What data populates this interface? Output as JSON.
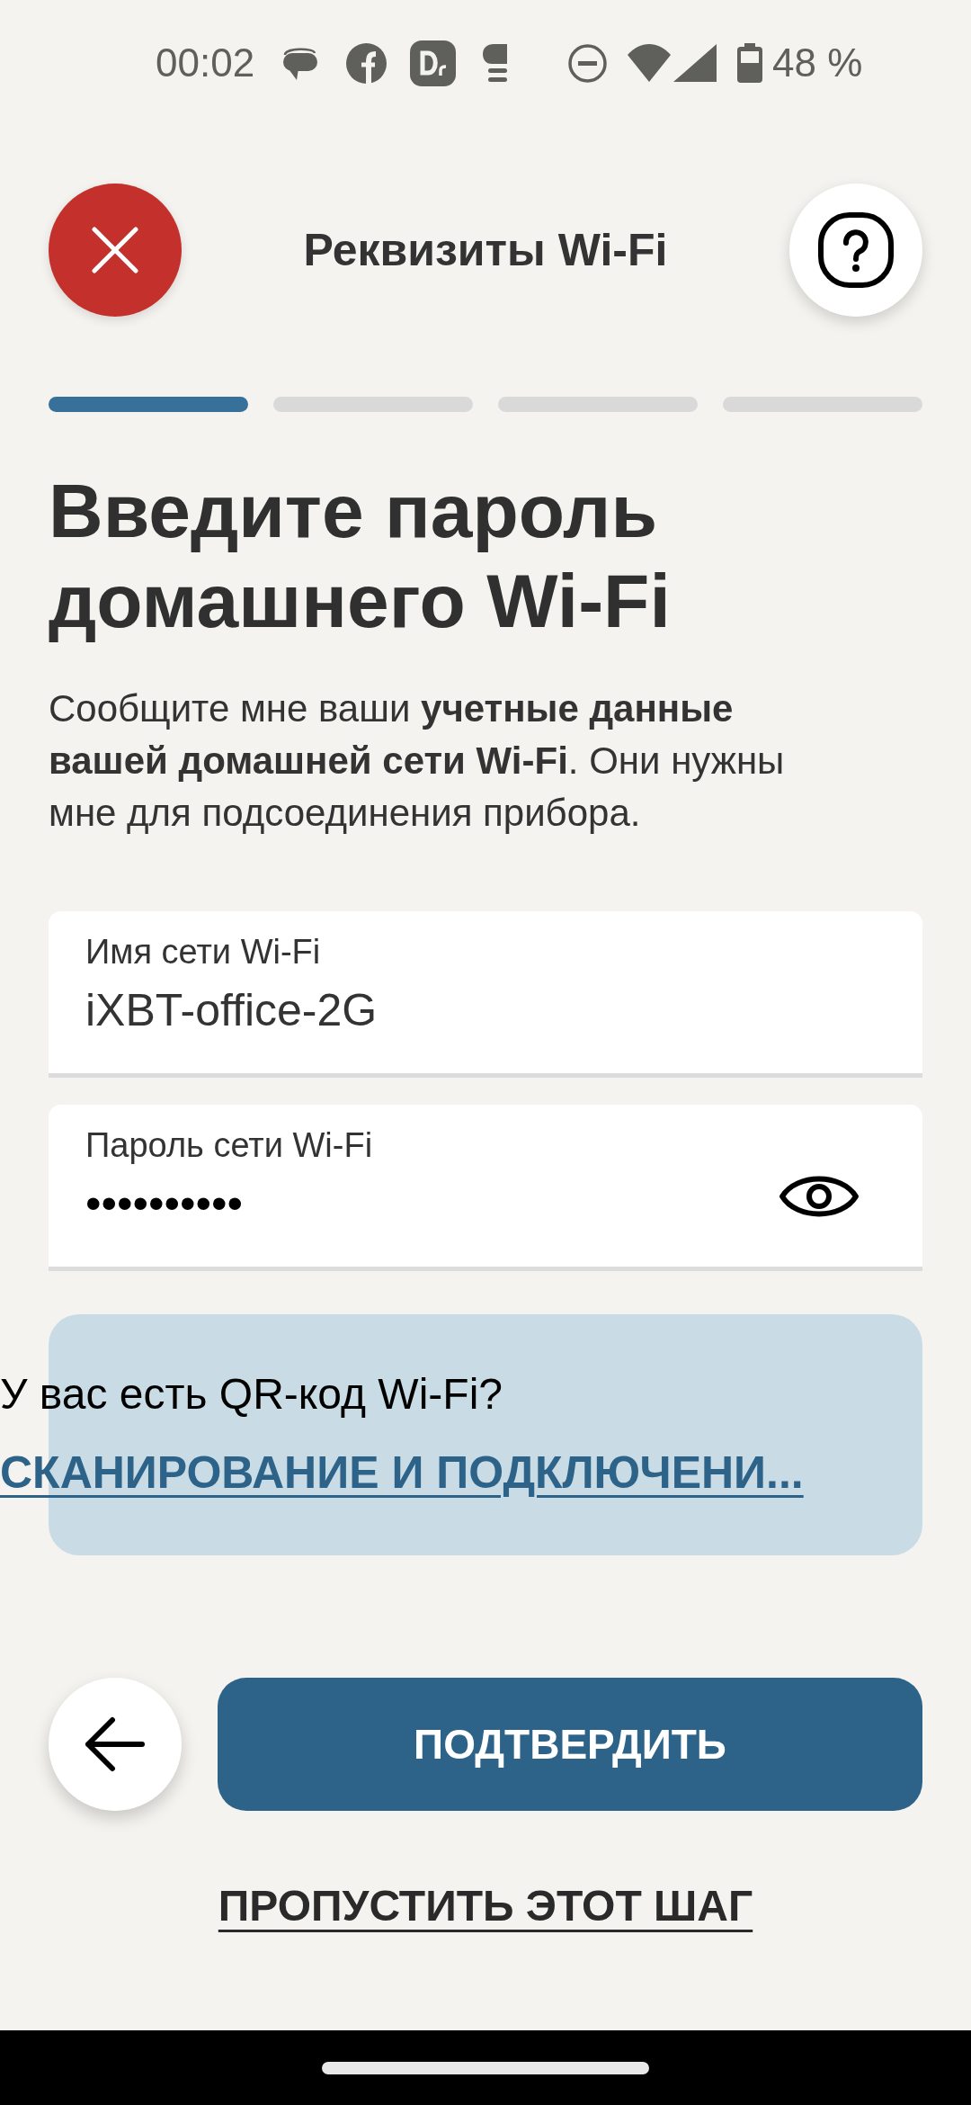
{
  "status_bar": {
    "time": "00:02",
    "battery": "48 %"
  },
  "header": {
    "title": "Реквизиты Wi-Fi"
  },
  "progress": {
    "steps": [
      {
        "active": true
      },
      {
        "active": false
      },
      {
        "active": false
      },
      {
        "active": false
      }
    ]
  },
  "heading": "Введите пароль домашнего Wi-Fi",
  "intro": "Сообщите мне ваши **учетные данные вашей домашней сети Wi-Fi**. Они нужны мне для подсоединения прибора.",
  "fields": [
    {
      "kind": "text",
      "label": "Имя сети Wi-Fi",
      "value": "iXBT-office-2G"
    },
    {
      "kind": "password",
      "label": "Пароль сети Wi-Fi",
      "value": "••••••••••"
    }
  ],
  "qr_card": {
    "question": "У вас есть QR-код Wi-Fi?",
    "link": "СКАНИРОВАНИЕ И ПОДКЛЮЧЕНИ..."
  },
  "actions": {
    "confirm": "ПОДТВЕРДИТЬ",
    "skip": "ПРОПУСТИТЬ ЭТОТ ШАГ"
  }
}
